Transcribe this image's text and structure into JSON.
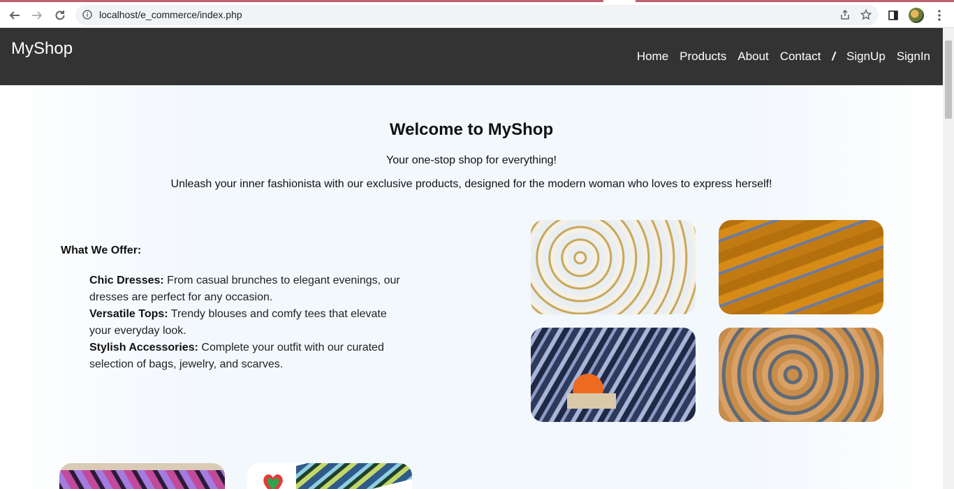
{
  "browser": {
    "url": "localhost/e_commerce/index.php",
    "icons": [
      "back-arrow-icon",
      "forward-arrow-icon",
      "reload-icon",
      "info-icon",
      "share-icon",
      "star-icon",
      "sidepanel-icon",
      "profile-avatar",
      "menu-dots-icon"
    ]
  },
  "site": {
    "brand": "MyShop",
    "nav": {
      "home": "Home",
      "products": "Products",
      "about": "About",
      "contact": "Contact",
      "separator": "/",
      "signup": "SignUp",
      "signin": "SignIn"
    }
  },
  "hero": {
    "title": "Welcome to MyShop",
    "tagline": "Your one-stop shop for everything!",
    "description": "Unleash your inner fashionista with our exclusive products, designed for the modern woman who loves to express herself!"
  },
  "offer": {
    "title": "What We Offer:",
    "items": [
      {
        "name": "Chic Dresses:",
        "text": " From casual brunches to elegant evenings, our dresses are perfect for any occasion."
      },
      {
        "name": "Versatile Tops:",
        "text": " Trendy blouses and comfy tees that elevate your everyday look."
      },
      {
        "name": "Stylish Accessories:",
        "text": " Complete your outfit with our curated selection of bags, jewelry, and scarves."
      }
    ]
  },
  "colors": {
    "header_bg": "#333333",
    "accent_strip": "#c0606e"
  }
}
